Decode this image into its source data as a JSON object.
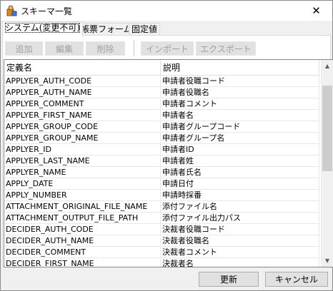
{
  "window": {
    "title": "スキーマ一覧",
    "close_glyph": "✕"
  },
  "tabs": [
    {
      "label": "システム(変更不可)",
      "active": true
    },
    {
      "label": "帳票フォーム",
      "active": false
    },
    {
      "label": "固定値",
      "active": false
    }
  ],
  "toolbar": {
    "add_label": "追加",
    "edit_label": "編集",
    "delete_label": "削除",
    "import_label": "インポート",
    "export_label": "エクスポート"
  },
  "grid": {
    "columns": [
      "定義名",
      "説明"
    ],
    "rows": [
      [
        "APPLYER_AUTH_CODE",
        "申請者役職コード"
      ],
      [
        "APPLYER_AUTH_NAME",
        "申請者役職名"
      ],
      [
        "APPLYER_COMMENT",
        "申請者コメント"
      ],
      [
        "APPLYER_FIRST_NAME",
        "申請者名"
      ],
      [
        "APPLYER_GROUP_CODE",
        "申請者グループコード"
      ],
      [
        "APPLYER_GROUP_NAME",
        "申請者グループ名"
      ],
      [
        "APPLYER_ID",
        "申請者ID"
      ],
      [
        "APPLYER_LAST_NAME",
        "申請者姓"
      ],
      [
        "APPLYER_NAME",
        "申請者氏名"
      ],
      [
        "APPLY_DATE",
        "申請日付"
      ],
      [
        "APPLY_NUMBER",
        "申請時採番"
      ],
      [
        "ATTACHMENT_ORIGINAL_FILE_NAME",
        "添付ファイル名"
      ],
      [
        "ATTACHMENT_OUTPUT_FILE_PATH",
        "添付ファイル出力パス"
      ],
      [
        "DECIDER_AUTH_CODE",
        "決裁者役職コード"
      ],
      [
        "DECIDER_AUTH_NAME",
        "決裁者役職名"
      ],
      [
        "DECIDER_COMMENT",
        "決裁者コメント"
      ],
      [
        "DECIDER_FIRST_NAME",
        "決裁者名"
      ]
    ]
  },
  "footer": {
    "update_label": "更新",
    "cancel_label": "キャンセル"
  },
  "colors": {
    "disabled_text": "#a0a0a0",
    "button_face": "#e1e1e1",
    "grid_border": "#828790"
  }
}
